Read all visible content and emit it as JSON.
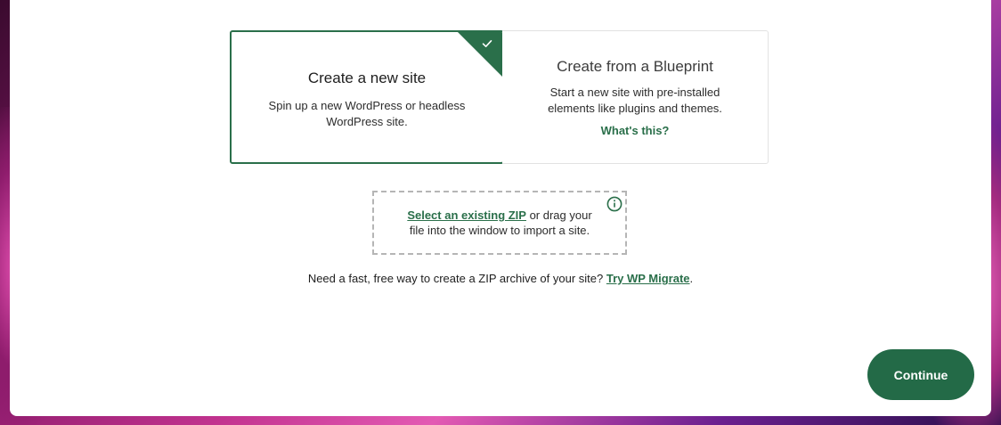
{
  "cards": {
    "new_site": {
      "title": "Create a new site",
      "line1": "Spin up a new WordPress or headless",
      "line2": "WordPress site.",
      "selected": true
    },
    "blueprint": {
      "title": "Create from a Blueprint",
      "line1": "Start a new site with pre-installed",
      "line2": "elements like plugins and themes.",
      "link": "What's this?",
      "selected": false
    }
  },
  "dropzone": {
    "link": "Select an existing ZIP",
    "text1": " or drag your",
    "text2": "file into the window to import a site."
  },
  "migrate": {
    "text": "Need a fast, free way to create a ZIP archive of your site? ",
    "link": "Try WP Migrate",
    "suffix": "."
  },
  "footer": {
    "continue_label": "Continue"
  },
  "colors": {
    "accent": "#2a6f4a",
    "button": "#236a47"
  },
  "icons": {
    "selected_indicator": "check-icon",
    "dropzone_info": "info-icon"
  }
}
